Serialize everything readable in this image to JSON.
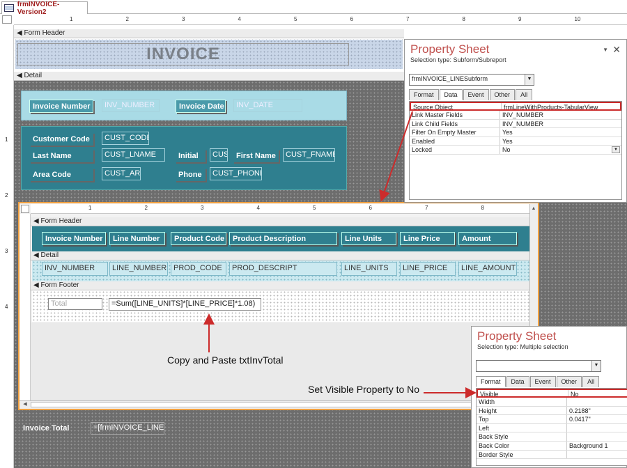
{
  "tab": {
    "title": "frmINVOICE-Version2",
    "icon": "form-icon"
  },
  "ruler_marks": [
    "1",
    "2",
    "3",
    "4",
    "5",
    "6",
    "7",
    "8",
    "9",
    "10"
  ],
  "sub_ruler_marks": [
    "1",
    "2",
    "3",
    "4",
    "5",
    "6",
    "7",
    "8"
  ],
  "side_ruler_marks": [
    "1",
    "2",
    "3",
    "4"
  ],
  "form_header": {
    "label": "Form Header",
    "title": "INVOICE"
  },
  "detail": {
    "label": "Detail"
  },
  "invoice_box": {
    "inv_number_label": "Invoice Number",
    "inv_number_field": "INV_NUMBER",
    "inv_date_label": "Invoice Date",
    "inv_date_field": "INV_DATE"
  },
  "customer_box": {
    "cust_code_label": "Customer Code",
    "cust_code_field": "CUST_CODE",
    "last_name_label": "Last Name",
    "last_name_field": "CUST_LNAME",
    "initial_label": "Initial",
    "initial_field": "CUST",
    "first_name_label": "First Name",
    "first_name_field": "CUST_FNAME",
    "area_code_label": "Area Code",
    "area_code_field": "CUST_ARE",
    "phone_label": "Phone",
    "phone_field": "CUST_PHONE"
  },
  "subform": {
    "form_header_label": "Form Header",
    "headers": [
      "Invoice Number",
      "Line Number",
      "Product Code",
      "Product Description",
      "Line Units",
      "Line Price",
      "Amount"
    ],
    "detail_label": "Detail",
    "fields": [
      "INV_NUMBER",
      "LINE_NUMBER",
      "PROD_CODE",
      "PROD_DESCRIPT",
      "LINE_UNITS",
      "LINE_PRICE",
      "LINE_AMOUNT"
    ],
    "form_footer_label": "Form Footer",
    "total_label": "Total",
    "total_formula": "=Sum([LINE_UNITS]*[LINE_PRICE]*1.08)"
  },
  "invoice_total": {
    "label": "Invoice Total",
    "field": "=[frmINVOICE_LINE"
  },
  "property_sheet_1": {
    "title": "Property Sheet",
    "selection_type": "Selection type:  Subform/Subreport",
    "combo": "frmINVOICE_LINESubform",
    "tabs": [
      "Format",
      "Data",
      "Event",
      "Other",
      "All"
    ],
    "active_tab": "Data",
    "rows": [
      {
        "name": "Source Object",
        "value": "frmLineWithProducts-TabularView"
      },
      {
        "name": "Link Master Fields",
        "value": "INV_NUMBER"
      },
      {
        "name": "Link Child Fields",
        "value": "INV_NUMBER"
      },
      {
        "name": "Filter On Empty Master",
        "value": "Yes"
      },
      {
        "name": "Enabled",
        "value": "Yes"
      },
      {
        "name": "Locked",
        "value": "No"
      }
    ]
  },
  "property_sheet_2": {
    "title": "Property Sheet",
    "selection_type": "Selection type:  Multiple selection",
    "combo": "",
    "tabs": [
      "Format",
      "Data",
      "Event",
      "Other",
      "All"
    ],
    "active_tab": "Format",
    "rows": [
      {
        "name": "Visible",
        "value": "No"
      },
      {
        "name": "Width",
        "value": ""
      },
      {
        "name": "Height",
        "value": "0.2188\""
      },
      {
        "name": "Top",
        "value": "0.0417\""
      },
      {
        "name": "Left",
        "value": ""
      },
      {
        "name": "Back Style",
        "value": ""
      },
      {
        "name": "Back Color",
        "value": "Background 1"
      },
      {
        "name": "Border Style",
        "value": ""
      }
    ]
  },
  "annotations": {
    "copy_paste": "Copy and Paste txtInvTotal",
    "set_visible": "Set Visible Property to No"
  },
  "colors": {
    "teal": "#2f7f8f",
    "light_teal": "#a9dbe6",
    "red": "#cc2b2b",
    "orange": "#f0a040",
    "title_red": "#c0504d"
  }
}
